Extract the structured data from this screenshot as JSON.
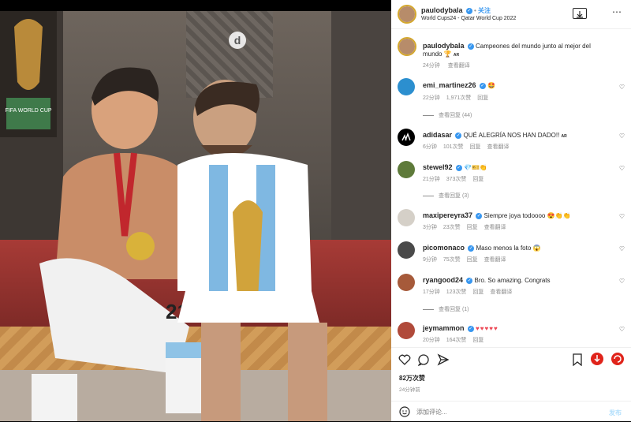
{
  "post": {
    "author": "paulodybala",
    "follow": "关注",
    "location": "World Cups24 - Qatar World Cup 2022",
    "caption_user": "paulodybala",
    "caption": "Campeones del mundo junto al mejor del",
    "caption_line2": "mundo",
    "caption_tag": "AR",
    "caption_time": "24分钟",
    "caption_translate": "查看翻译",
    "likes": "82万次赞",
    "posted_ago": "24分钟前",
    "add_comment_placeholder": "添加评论...",
    "post_button": "发布",
    "photo_overlay_logo": "d",
    "trophy_text": "FIFA WORLD CUP",
    "jersey_number": "21"
  },
  "comments": [
    {
      "user": "emi_martinez26",
      "text": "🤩",
      "time": "22分钟",
      "likes": "1,971次赞",
      "reply": "回复",
      "view_replies": "查看回复 (44)"
    },
    {
      "user": "adidasar",
      "text": "QUÉ ALEGRÍA NOS HAN DADO!!",
      "tag": "AR",
      "time": "6分钟",
      "likes": "101次赞",
      "reply": "回复",
      "translate": "查看翻译"
    },
    {
      "user": "stewel92",
      "text": "💎🎫👏",
      "time": "21分钟",
      "likes": "373次赞",
      "reply": "回复",
      "view_replies": "查看回复 (3)"
    },
    {
      "user": "maxipereyra37",
      "text": "Siempre joya todoooo 😍👏👏",
      "time": "3分钟",
      "likes": "23次赞",
      "reply": "回复",
      "translate": "查看翻译"
    },
    {
      "user": "picomonaco",
      "text": "Maso menos la foto 😱",
      "time": "9分钟",
      "likes": "75次赞",
      "reply": "回复",
      "translate": "查看翻译"
    },
    {
      "user": "ryangood24",
      "text": "Bro. So amazing. Congrats",
      "time": "17分钟",
      "likes": "123次赞",
      "reply": "回复",
      "translate": "查看翻译",
      "view_replies": "查看回复 (1)"
    },
    {
      "user": "jeymammon",
      "text": "♥♥♥♥♥",
      "time": "20分钟",
      "likes": "164次赞",
      "reply": "回复"
    }
  ],
  "colors": {
    "accent": "#3897f0",
    "ring": "#d4a72c",
    "text": "#262626",
    "muted": "#8e8e8e",
    "red": "#e0241b"
  }
}
